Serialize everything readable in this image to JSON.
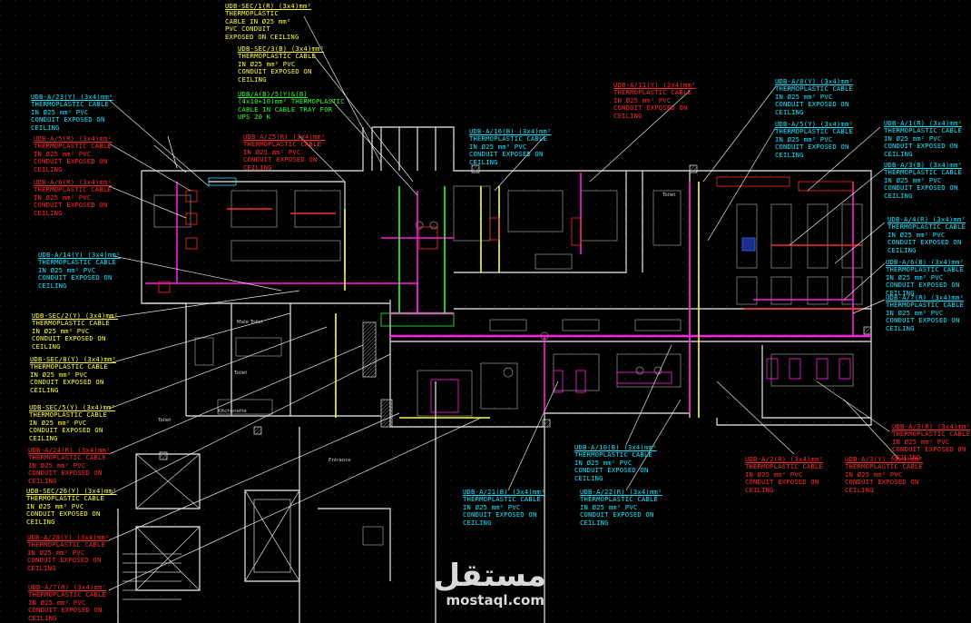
{
  "colors": {
    "background": "#000000",
    "wall": "#c8c8c8",
    "furniture": "#9a9a9a",
    "cable_magenta": "#ff1fe0",
    "cyan": "#19e6ff",
    "red": "#ff2a2a",
    "yellow": "#ffff33",
    "green": "#33ff33",
    "white": "#ffffff"
  },
  "labels": [
    {
      "id": "l1",
      "color": "yellow",
      "title": "UDB-SEC/1(R)  (3x4)mm²",
      "lines": [
        "THERMOPLASTIC",
        "CABLE IN Ø25 mm²",
        "PVC CONDUIT",
        "EXPOSED ON CEILING"
      ]
    },
    {
      "id": "l2",
      "color": "yellow",
      "title": "UDB-SEC/3(B)  (3x4)mm²",
      "lines": [
        "THERMOPLASTIC CABLE",
        "IN Ø25 mm² PVC",
        "CONDUIT EXPOSED ON",
        "CEILING"
      ]
    },
    {
      "id": "l3",
      "color": "green",
      "title": "UDB/A(B)/5(Y)&(B)",
      "lines": [
        "(4x10+10)mm² THERMOPLASTIC",
        "CABLE IN CABLE TRAY FOR",
        "UPS 20 K"
      ]
    },
    {
      "id": "l4",
      "color": "cyan",
      "title": "UDB-A/23(Y)  (3x4)mm²",
      "lines": [
        "THERMOPLASTIC CABLE",
        "IN Ø25 mm² PVC",
        "CONDUIT EXPOSED ON",
        "CEILING"
      ]
    },
    {
      "id": "l5",
      "color": "red",
      "title": "UDB-A/5(R)  (3x4)mm²",
      "lines": [
        "THERMOPLASTIC CABLE",
        "IN Ø25 mm² PVC",
        "CONDUIT EXPOSED ON",
        "CEILING"
      ]
    },
    {
      "id": "l6",
      "color": "red",
      "title": "UDB-A/25(R)  (3x4)mm²",
      "lines": [
        "THERMOPLASTIC CABLE",
        "IN Ø25 mm² PVC",
        "CONDUIT EXPOSED ON",
        "CEILING"
      ]
    },
    {
      "id": "l7",
      "color": "red",
      "title": "UDB-A/6(R)  (3x4)mm²",
      "lines": [
        "THERMOPLASTIC CABLE",
        "IN Ø25 mm² PVC",
        "CONDUIT EXPOSED ON",
        "CEILING"
      ]
    },
    {
      "id": "l8",
      "color": "cyan",
      "title": "UDB-A/16(B)  (3x4)mm²",
      "lines": [
        "THERMOPLASTIC CABLE",
        "IN Ø25 mm² PVC",
        "CONDUIT EXPOSED ON",
        "CEILING"
      ]
    },
    {
      "id": "l9",
      "color": "red",
      "title": "UDB-A/11(Y)  (3x4)mm²",
      "lines": [
        "THERMOPLASTIC CABLE",
        "IN Ø25 mm² PVC",
        "CONDUIT EXPOSED ON",
        "CEILING"
      ]
    },
    {
      "id": "l10",
      "color": "cyan",
      "title": "UDB-A/8(Y)  (3x4)mm²",
      "lines": [
        "THERMOPLASTIC CABLE",
        "IN Ø25 mm² PVC",
        "CONDUIT EXPOSED ON",
        "CEILING"
      ]
    },
    {
      "id": "l11",
      "color": "cyan",
      "title": "UDB-A/5(Y)  (3x4)mm²",
      "lines": [
        "THERMOPLASTIC CABLE",
        "IN Ø25 mm² PVC",
        "CONDUIT EXPOSED ON",
        "CEILING"
      ]
    },
    {
      "id": "l12",
      "color": "cyan",
      "title": "UDB-A/1(R)  (3x4)mm²",
      "lines": [
        "THERMOPLASTIC CABLE",
        "IN Ø25 mm² PVC",
        "CONDUIT EXPOSED ON",
        "CEILING"
      ]
    },
    {
      "id": "l13",
      "color": "cyan",
      "title": "UDB-A/3(B)  (3x4)mm²",
      "lines": [
        "THERMOPLASTIC CABLE",
        "IN Ø25 mm² PVC",
        "CONDUIT EXPOSED ON",
        "CEILING"
      ]
    },
    {
      "id": "l14",
      "color": "cyan",
      "title": "UDB-A/14(Y)  (3x4)mm²",
      "lines": [
        "THERMOPLASTIC CABLE",
        "IN Ø25 mm² PVC",
        "CONDUIT EXPOSED ON",
        "CEILING"
      ]
    },
    {
      "id": "l15",
      "color": "cyan",
      "title": "UDB-A/4(R)  (3x4)mm²",
      "lines": [
        "THERMOPLASTIC CABLE",
        "IN Ø25 mm² PVC",
        "CONDUIT EXPOSED ON",
        "CEILING"
      ]
    },
    {
      "id": "l16",
      "color": "cyan",
      "title": "UDB-A/6(B)  (3x4)mm²",
      "lines": [
        "THERMOPLASTIC CABLE",
        "IN Ø25 mm² PVC",
        "CONDUIT EXPOSED ON",
        "CEILING"
      ]
    },
    {
      "id": "l17",
      "color": "cyan",
      "title": "UDB-A/7(R)  (3x4)mm²",
      "lines": [
        "THERMOPLASTIC CABLE",
        "IN Ø25 mm² PVC",
        "CONDUIT EXPOSED ON",
        "CEILING"
      ]
    },
    {
      "id": "l18",
      "color": "yellow",
      "title": "UDB-SEC/2(Y)  (3x4)mm²",
      "lines": [
        "THERMOPLASTIC CABLE",
        "IN Ø25 mm² PVC",
        "CONDUIT EXPOSED ON",
        "CEILING"
      ]
    },
    {
      "id": "l19",
      "color": "yellow",
      "title": "UDB-SEC/8(Y)  (3x4)mm²",
      "lines": [
        "THERMOPLASTIC CABLE",
        "IN Ø25 mm² PVC",
        "CONDUIT EXPOSED ON",
        "CEILING"
      ]
    },
    {
      "id": "l20",
      "color": "yellow",
      "title": "UDB-SEC/5(Y)  (3x4)mm²",
      "lines": [
        "THERMOPLASTIC CABLE",
        "IN Ø25 mm² PVC",
        "CONDUIT EXPOSED ON",
        "CEILING"
      ]
    },
    {
      "id": "l21",
      "color": "red",
      "title": "UDB-A/24(R)  (3x4)mm²",
      "lines": [
        "THERMOPLASTIC CABLE",
        "IN Ø25 mm² PVC",
        "CONDUIT EXPOSED ON",
        "CEILING"
      ]
    },
    {
      "id": "l22",
      "color": "yellow",
      "title": "UDB-SEC/26(Y)  (3x4)mm²",
      "lines": [
        "THERMOPLASTIC CABLE",
        "IN Ø25 mm² PVC",
        "CONDUIT EXPOSED ON",
        "CEILING"
      ]
    },
    {
      "id": "l23",
      "color": "red",
      "title": "UDB-A/28(Y)  (3x4)mm²",
      "lines": [
        "THERMOPLASTIC CABLE",
        "IN Ø25 mm² PVC",
        "CONDUIT EXPOSED ON",
        "CEILING"
      ]
    },
    {
      "id": "l24",
      "color": "red",
      "title": "UDB-A/7(R)  (3x4)mm²",
      "lines": [
        "THERMOPLASTIC CABLE",
        "IN Ø25 mm² PVC",
        "CONDUIT EXPOSED ON",
        "CEILING"
      ]
    },
    {
      "id": "l25",
      "color": "cyan",
      "title": "UDB-A/21(B)  (3x4)mm²",
      "lines": [
        "THERMOPLASTIC CABLE",
        "IN Ø25 mm² PVC",
        "CONDUIT EXPOSED ON",
        "CEILING"
      ]
    },
    {
      "id": "l26",
      "color": "cyan",
      "title": "UDB-A/10(B)  (3x4)mm²",
      "lines": [
        "THERMOPLASTIC CABLE",
        "IN Ø25 mm² PVC",
        "CONDUIT EXPOSED ON",
        "CEILING"
      ]
    },
    {
      "id": "l27",
      "color": "cyan",
      "title": "UDB-A/22(R)  (3x4)mm²",
      "lines": [
        "THERMOPLASTIC CABLE",
        "IN Ø25 mm² PVC",
        "CONDUIT EXPOSED ON",
        "CEILING"
      ]
    },
    {
      "id": "l28",
      "color": "red",
      "title": "UDB-A/3(R)  (3x4)mm²",
      "lines": [
        "THERMOPLASTIC CABLE",
        "IN Ø25 mm² PVC",
        "CONDUIT EXPOSED ON",
        "CEILING"
      ]
    },
    {
      "id": "l29",
      "color": "red",
      "title": "UDB-A/2(R)  (3x4)mm²",
      "lines": [
        "THERMOPLASTIC CABLE",
        "IN Ø25 mm² PVC",
        "CONDUIT EXPOSED ON",
        "CEILING"
      ]
    },
    {
      "id": "l30",
      "color": "red",
      "title": "UDB-A/3(Y)  (3x4)mm²",
      "lines": [
        "THERMOPLASTIC CABLE",
        "IN Ø25 mm² PVC",
        "CONDUIT EXPOSED ON",
        "CEILING"
      ]
    }
  ],
  "rooms": {
    "male_toilet": "Male Toilet",
    "toilet_1": "Toilet",
    "toilet_2": "Toilet",
    "toilet_3": "Toilet",
    "kitchenette": "Kitchenette",
    "entrance": "Entrance"
  },
  "watermark": {
    "arabic": "مستقل",
    "latin": "mostaql.com"
  }
}
